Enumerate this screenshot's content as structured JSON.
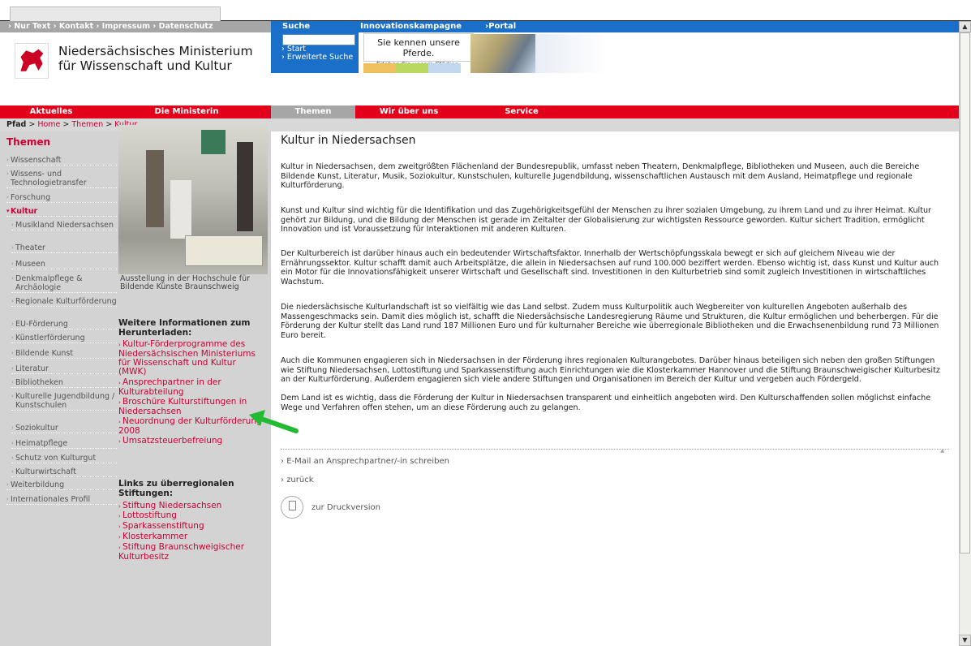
{
  "meta_links": [
    "Nur Text",
    "Kontakt",
    "Impressum",
    "Datenschutz"
  ],
  "ministry": {
    "line1": "Niedersächsisches Ministerium",
    "line2": "für Wissenschaft und Kultur"
  },
  "bluebar": {
    "suche": "Suche",
    "innovation": "Innovationskampagne",
    "portal": "Portal Niedersachsen"
  },
  "search": {
    "placeholder": "",
    "start": "Start",
    "erweiterte": "Erweiterte Suche"
  },
  "banner": {
    "line1": "Sie kennen unsere Pferde.",
    "line2": "Erleben Sie unsere Stärken."
  },
  "nav": {
    "aktuelles": "Aktuelles",
    "ministerin": "Die Ministerin",
    "themen": "Themen",
    "wir": "Wir über uns",
    "service": "Service"
  },
  "path": {
    "label": "Pfad",
    "home": "Home",
    "themen": "Themen",
    "kultur": "Kultur"
  },
  "sidebar": {
    "title": "Themen",
    "items": [
      {
        "label": "Wissenschaft"
      },
      {
        "label": "Wissens- und Technologietransfer"
      },
      {
        "label": "Forschung"
      },
      {
        "label": "Kultur"
      },
      {
        "label": "Musikland Niedersachsen"
      },
      {
        "label": "Theater"
      },
      {
        "label": "Museen"
      },
      {
        "label": "Denkmalpflege & Archäologie"
      },
      {
        "label": "Regionale Kulturförderung"
      },
      {
        "label": "EU-Förderung"
      },
      {
        "label": "Künstlerförderung"
      },
      {
        "label": "Bildende Kunst"
      },
      {
        "label": "Literatur"
      },
      {
        "label": "Bibliotheken"
      },
      {
        "label": "Kulturelle Jugendbildung / Kunstschulen"
      },
      {
        "label": "Soziokultur"
      },
      {
        "label": "Heimatpflege"
      },
      {
        "label": "Schutz von Kulturgut"
      },
      {
        "label": "Kulturwirtschaft"
      },
      {
        "label": "Weiterbildung"
      },
      {
        "label": "Internationales Profil"
      }
    ]
  },
  "photo_caption": "Ausstellung in der Hochschule für Bildende Künste Braunschweig",
  "weitere": {
    "heading": "Weitere Informationen zum Herunterladen:",
    "links": [
      "Kultur-Förderprogramme des Niedersächsischen Ministeriums für Wissenschaft und Kultur (MWK)",
      "Ansprechpartner in der Kulturabteilung",
      "Broschüre Kulturstiftungen in Niedersachsen",
      "Neuordnung der Kulturförderung 2008",
      "Umsatzsteuerbefreiung"
    ]
  },
  "stiftungen": {
    "heading": "Links zu überregionalen Stiftungen:",
    "links": [
      "Stiftung Niedersachsen",
      "Lottostiftung",
      "Sparkassenstiftung",
      "Klosterkammer",
      "Stiftung Braunschweigischer Kulturbesitz"
    ]
  },
  "main": {
    "title": "Kultur in Niedersachsen",
    "paragraphs": [
      "Kultur in Niedersachsen, dem zweitgrößten Flächenland der Bundesrepublik, umfasst neben Theatern, Denkmalpflege, Bibliotheken und Museen, auch die Bereiche Bildende Kunst, Literatur, Musik, Soziokultur, Kunstschulen, kulturelle Jugendbildung, wissenschaftlichen Austausch mit dem Ausland, Heimatpflege und regionale Kulturförderung.",
      "Kunst und Kultur sind wichtig für die Identifikation und das Zugehörigkeitsgefühl der Menschen zu ihrer sozialen Umgebung, zu ihrem Land und zu ihrer Heimat. Kultur gehört zur Bildung, und die Bildung der Menschen ist gerade im Zeitalter der Globalisierung zur wichtigsten Ressource geworden. Kultur sichert Tradition, ermöglicht Innovation und ist Voraussetzung für Interaktionen mit anderen Kulturen.",
      "Der Kulturbereich ist darüber hinaus auch ein bedeutender Wirtschaftsfaktor. Innerhalb der Wertschöpfungsskala bewegt er sich auf gleichem Niveau wie der Ernährungssektor. Kultur schafft damit auch Arbeitsplätze, die allein in Niedersachsen auf rund 100.000 beziffert werden. Ebenso wichtig ist, dass Kunst und Kultur auch ein Motor für die Innovationsfähigkeit unserer Wirtschaft und Gesellschaft sind. Investitionen in den Kulturbetrieb sind somit zugleich Investitionen in wirtschaftliches Wachstum.",
      "Die niedersächsische Kulturlandschaft ist so vielfältig wie das Land selbst. Zudem muss Kulturpolitik auch Wegbereiter von kulturellen Angeboten außerhalb des Massengeschmacks sein. Damit dies möglich ist, schafft die Niedersächsische Landesregierung Räume und Strukturen, die Kultur ermöglichen und beherbergen. Für die Förderung der Kultur stellt das Land rund 187 Millionen Euro und für kulturnaher Bereiche wie überregionale Bibliotheken und die Erwachsenenbildung rund 73 Millionen Euro bereit.",
      "Auch die Kommunen engagieren sich in Niedersachsen in der Förderung ihres regionalen Kulturangebotes.  Darüber hinaus beteiligen sich neben den großen Stiftungen wie Stiftung Niedersachsen, Lottostiftung und Sparkassenstiftung auch Einrichtungen wie die Klosterkammer Hannover und die Stiftung Braunschweigischer Kulturbesitz an der Kulturförderung. Außerdem engagieren sich viele andere Stiftungen und Organisationen im Bereich der Kultur und vergeben auch Fördergeld.",
      "Dem Land ist es wichtig, dass die Förderung der Kultur in Niedersachsen transparent und einheitlich angeboten wird. Den Kulturschaffenden sollen möglichst einfache Wege und Verfahren offen stehen, um an diese Förderung auch zu gelangen."
    ],
    "email": "E-Mail an Ansprechpartner/-in schreiben",
    "back": "zurück",
    "print": "zur Druckversion"
  },
  "colors": {
    "red": "#e2001a",
    "blue": "#1a6fc8",
    "grey": "#d3d3d3",
    "link": "#cc0033",
    "arrow": "#22bb33"
  }
}
